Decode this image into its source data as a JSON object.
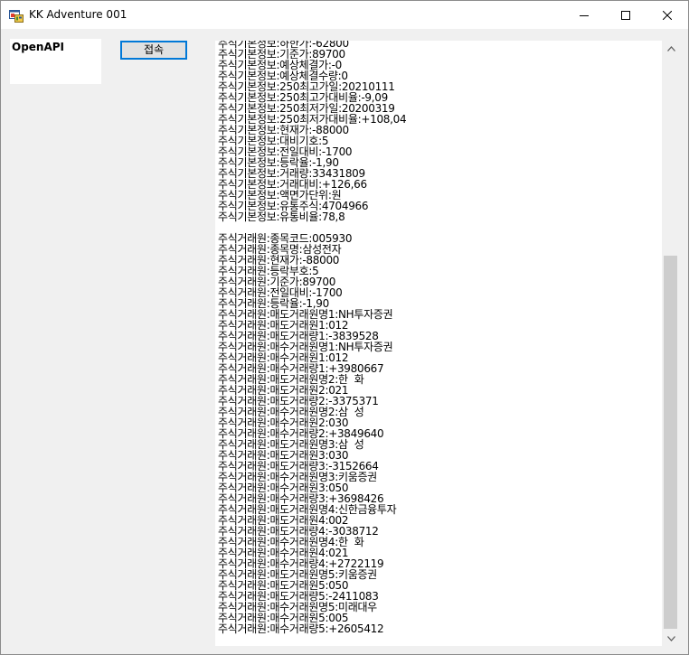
{
  "window": {
    "title": "KK Adventure 001"
  },
  "left_panel": {
    "label": "OpenAPI"
  },
  "toolbar": {
    "connect_label": "접속"
  },
  "log_lines": [
    "주식기본정보:하한가:-62800",
    "주식기본정보:기준가:89700",
    "주식기본정보:예상체결가:-0",
    "주식기본정보:예상체결수량:0",
    "주식기본정보:250최고가일:20210111",
    "주식기본정보:250최고가대비율:-9,09",
    "주식기본정보:250최저가일:20200319",
    "주식기본정보:250최저가대비율:+108,04",
    "주식기본정보:현재가:-88000",
    "주식기본정보:대비기호:5",
    "주식기본정보:전일대비:-1700",
    "주식기본정보:등락율:-1,90",
    "주식기본정보:거래량:33431809",
    "주식기본정보:거래대비:+126,66",
    "주식기본정보:액면가단위:원",
    "주식기본정보:유통주식:4704966",
    "주식기본정보:유통비율:78,8",
    "",
    "주식거래원:종목코드:005930",
    "주식거래원:종목명:삼성전자",
    "주식거래원:현재가:-88000",
    "주식거래원:등락부호:5",
    "주식거래원:기준가:89700",
    "주식거래원:전일대비:-1700",
    "주식거래원:등락율:-1,90",
    "주식거래원:매도거래원명1:NH투자증권",
    "주식거래원:매도거래원1:012",
    "주식거래원:매도거래량1:-3839528",
    "주식거래원:매수거래원명1:NH투자증권",
    "주식거래원:매수거래원1:012",
    "주식거래원:매수거래량1:+3980667",
    "주식거래원:매도거래원명2:한  화",
    "주식거래원:매도거래원2:021",
    "주식거래원:매도거래량2:-3375371",
    "주식거래원:매수거래원명2:삼  성",
    "주식거래원:매수거래원2:030",
    "주식거래원:매수거래량2:+3849640",
    "주식거래원:매도거래원명3:삼  성",
    "주식거래원:매도거래원3:030",
    "주식거래원:매도거래량3:-3152664",
    "주식거래원:매수거래원명3:키움증권",
    "주식거래원:매수거래원3:050",
    "주식거래원:매수거래량3:+3698426",
    "주식거래원:매도거래원명4:신한금융투자",
    "주식거래원:매도거래원4:002",
    "주식거래원:매도거래량4:-3038712",
    "주식거래원:매수거래원명4:한  화",
    "주식거래원:매수거래원4:021",
    "주식거래원:매수거래량4:+2722119",
    "주식거래원:매도거래원명5:키움증권",
    "주식거래원:매도거래원5:050",
    "주식거래원:매도거래량5:-2411083",
    "주식거래원:매수거래원명5:미래대우",
    "주식거래원:매수거래원5:005",
    "주식거래원:매수거래량5:+2605412"
  ],
  "icons": {
    "app": "app-window-icon",
    "minimize": "minimize-icon",
    "maximize": "maximize-icon",
    "close": "close-icon",
    "scroll_up": "chevron-up-icon",
    "scroll_down": "chevron-down-icon"
  },
  "colors": {
    "focus_border": "#0078d7",
    "button_face": "#e1e1e1",
    "window_background": "#f0f0f0",
    "scroll_thumb": "#cdcdcd"
  }
}
